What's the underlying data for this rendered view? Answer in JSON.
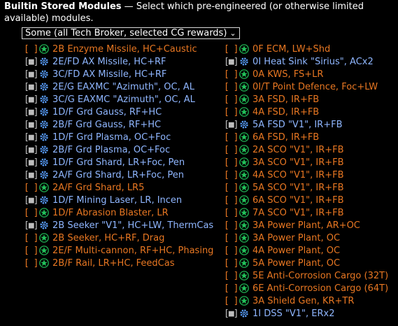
{
  "header": {
    "title": "Builtin Stored Modules",
    "dash": " — ",
    "description": "Select which pre-engineered (or otherwise limited available) modules."
  },
  "dropdown": {
    "selected": "Some (all Tech Broker, selected CG rewards)"
  },
  "colors": {
    "unchecked_text": "#e87722",
    "checked_text": "#8fb6ff",
    "star_icon": "#22c25a",
    "gear_icon": "#5aa0ff"
  },
  "left_items": [
    {
      "checked": false,
      "icon": "star-icon",
      "label": "2B Enzyme Missile, HC+Caustic"
    },
    {
      "checked": true,
      "icon": "gear-icon",
      "label": "2E/FD AX Missile, HC+RF"
    },
    {
      "checked": true,
      "icon": "gear-icon",
      "label": "3C/FD AX Missile, HC+RF"
    },
    {
      "checked": true,
      "icon": "gear-icon",
      "label": "2E/G EAXMC \"Azimuth\", OC, AL"
    },
    {
      "checked": true,
      "icon": "gear-icon",
      "label": "3C/G EAXMC \"Azimuth\", OC, AL"
    },
    {
      "checked": true,
      "icon": "gear-icon",
      "label": "1D/F Grd Gauss, RF+HC"
    },
    {
      "checked": true,
      "icon": "gear-icon",
      "label": "2B/F Grd Gauss, RF+HC"
    },
    {
      "checked": true,
      "icon": "gear-icon",
      "label": "1D/F Grd Plasma, OC+Foc"
    },
    {
      "checked": true,
      "icon": "gear-icon",
      "label": "2B/F Grd Plasma, OC+Foc"
    },
    {
      "checked": true,
      "icon": "gear-icon",
      "label": "1D/F Grd Shard, LR+Foc, Pen"
    },
    {
      "checked": true,
      "icon": "gear-icon",
      "label": "2A/F Grd Shard, LR+Foc, Pen"
    },
    {
      "checked": false,
      "icon": "star-icon",
      "label": "2A/F Grd Shard, LR5"
    },
    {
      "checked": true,
      "icon": "gear-icon",
      "label": "1D/F Mining Laser, LR, Incen"
    },
    {
      "checked": false,
      "icon": "star-icon",
      "label": "1D/F Abrasion Blaster, LR"
    },
    {
      "checked": true,
      "icon": "gear-icon",
      "label": "2B Seeker \"V1\", HC+LW, ThermCas"
    },
    {
      "checked": false,
      "icon": "star-icon",
      "label": "2B Seeker, HC+RF, Drag"
    },
    {
      "checked": false,
      "icon": "star-icon",
      "label": "2E/F Multi-cannon, RF+HC, Phasing"
    },
    {
      "checked": false,
      "icon": "star-icon",
      "label": "2B/F Rail, LR+HC, FeedCas"
    }
  ],
  "right_items": [
    {
      "checked": false,
      "icon": "star-icon",
      "label": "0F ECM, LW+Shd"
    },
    {
      "checked": true,
      "icon": "gear-icon",
      "label": "0I Heat Sink \"Sirius\", ACx2"
    },
    {
      "checked": false,
      "icon": "star-icon",
      "label": "0A KWS, FS+LR"
    },
    {
      "checked": false,
      "icon": "star-icon",
      "label": "0I/T Point Defence, Foc+LW"
    },
    {
      "checked": false,
      "icon": "star-icon",
      "label": "3A FSD, IR+FB"
    },
    {
      "checked": false,
      "icon": "star-icon",
      "label": "4A FSD, IR+FB"
    },
    {
      "checked": true,
      "icon": "gear-icon",
      "label": "5A FSD \"V1\", IR+FB"
    },
    {
      "checked": false,
      "icon": "star-icon",
      "label": "6A FSD, IR+FB"
    },
    {
      "checked": false,
      "icon": "star-icon",
      "label": "2A SCO \"V1\", IR+FB"
    },
    {
      "checked": false,
      "icon": "star-icon",
      "label": "3A SCO \"V1\", IR+FB"
    },
    {
      "checked": false,
      "icon": "star-icon",
      "label": "4A SCO \"V1\", IR+FB"
    },
    {
      "checked": false,
      "icon": "star-icon",
      "label": "5A SCO \"V1\", IR+FB"
    },
    {
      "checked": false,
      "icon": "star-icon",
      "label": "6A SCO \"V1\", IR+FB"
    },
    {
      "checked": false,
      "icon": "star-icon",
      "label": "7A SCO \"V1\", IR+FB"
    },
    {
      "checked": false,
      "icon": "star-icon",
      "label": "3A Power Plant, AR+OC"
    },
    {
      "checked": false,
      "icon": "star-icon",
      "label": "3A Power Plant, OC"
    },
    {
      "checked": false,
      "icon": "star-icon",
      "label": "4A Power Plant, OC"
    },
    {
      "checked": false,
      "icon": "star-icon",
      "label": "5A Power Plant, OC"
    },
    {
      "checked": false,
      "icon": "star-icon",
      "label": "5E Anti-Corrosion Cargo (32T)"
    },
    {
      "checked": false,
      "icon": "star-icon",
      "label": "6E Anti-Corrosion Cargo (64T)"
    },
    {
      "checked": false,
      "icon": "star-icon",
      "label": "3A Shield Gen, KR+TR"
    },
    {
      "checked": true,
      "icon": "gear-icon",
      "label": "1I DSS \"V1\", ERx2"
    }
  ]
}
